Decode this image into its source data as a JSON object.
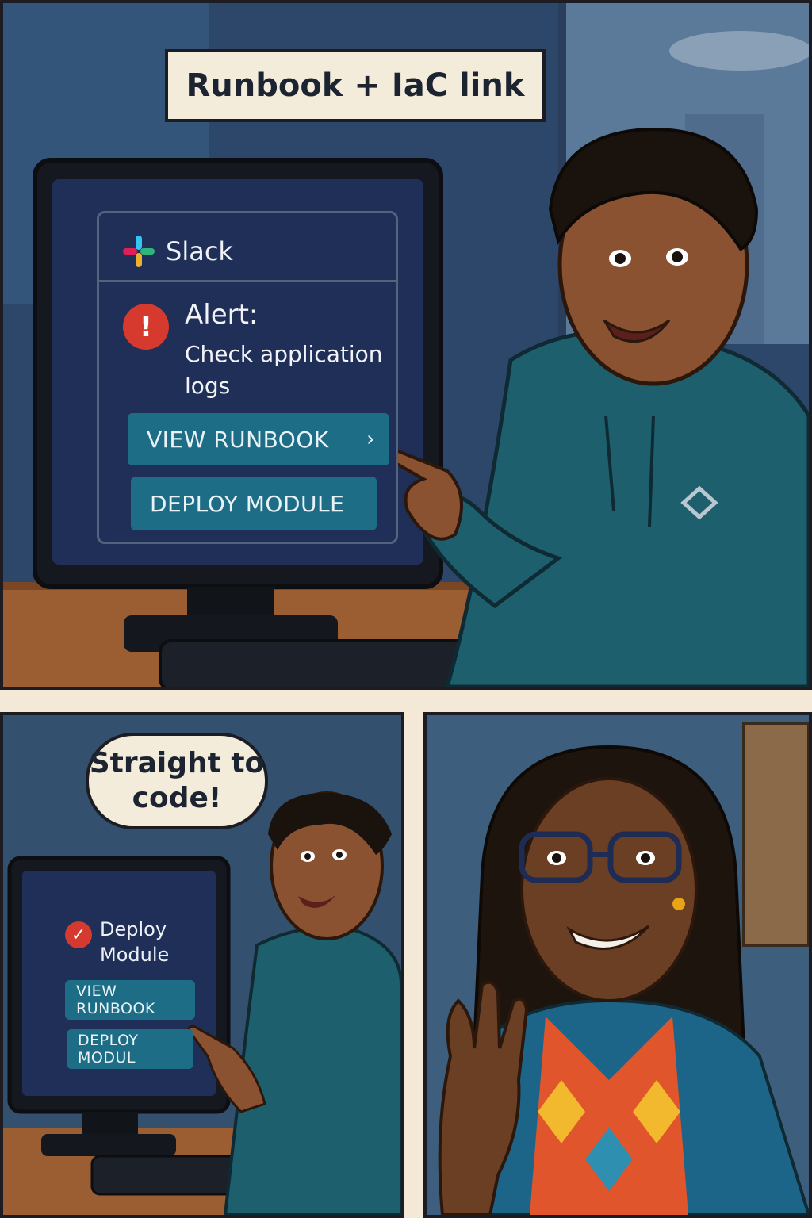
{
  "caption": {
    "title": "Runbook + IaC link"
  },
  "top_panel": {
    "app_name": "Slack",
    "alert_title": "Alert:",
    "alert_body": "Check application logs",
    "buttons": [
      {
        "label": "VIEW RUNBOOK",
        "chevron": "›"
      },
      {
        "label": "DEPLOY MODULE"
      }
    ]
  },
  "bottom_left_panel": {
    "speech": "Straight to code!",
    "status_label": "Deploy Module",
    "buttons": [
      {
        "label": "VIEW RUNBOOK"
      },
      {
        "label": "DEPLOY MODUL"
      }
    ]
  },
  "icons": {
    "slack": "slack-logo-icon",
    "alert": "exclamation-icon",
    "check": "check-icon",
    "hoodie_logo": "diamond-icon"
  },
  "colors": {
    "slack_card": "#1f2f57",
    "button": "#1d6d86",
    "alert_red": "#d63a2f",
    "hoodie": "#1e5f6e",
    "caption_bg": "#f4ecda"
  }
}
